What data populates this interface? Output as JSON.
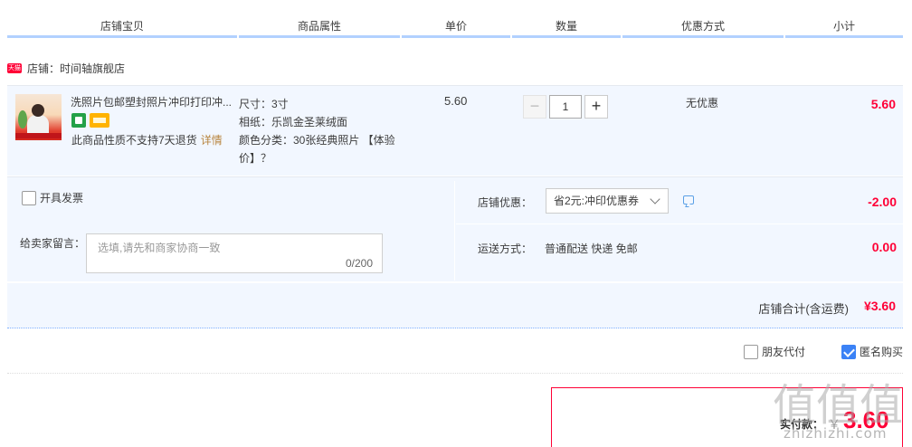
{
  "header": {
    "columns": [
      "店铺宝贝",
      "商品属性",
      "单价",
      "数量",
      "优惠方式",
      "小计"
    ]
  },
  "shop": {
    "badge": "天猫",
    "label": "店铺：时间轴旗舰店"
  },
  "item": {
    "title": "洗照片包邮塑封照片冲印打印冲...",
    "return_note": "此商品性质不支持7天退货",
    "detail_link": "详情",
    "attrs": [
      "尺寸：3寸",
      "相纸：乐凯金圣莱绒面",
      "颜色分类：30张经典照片 【体验价】？"
    ],
    "price": "5.60",
    "quantity": "1",
    "promo": "无优惠",
    "subtotal": "5.60"
  },
  "options": {
    "invoice_label": "开具发票",
    "message_label": "给卖家留言：",
    "message_placeholder": "选填,请先和商家协商一致",
    "message_count": "0/200",
    "coupon_label": "店铺优惠：",
    "coupon_value": "省2元:冲印优惠券",
    "coupon_amount": "-2.00",
    "shipping_label": "运送方式：",
    "shipping_value": "普通配送 快递 免邮",
    "shipping_amount": "0.00"
  },
  "total": {
    "label": "店铺合计(含运费)",
    "amount": "¥3.60"
  },
  "flags": {
    "friend_pay": "朋友代付",
    "anonymous": "匿名购买"
  },
  "pay": {
    "label": "实付款：",
    "currency": "￥",
    "amount": "3.60"
  },
  "watermark": {
    "glyphs": "值值值",
    "domain": "zhizhizhi.com"
  },
  "colors": {
    "accent_red": "#ff0036",
    "row_bg": "#f2f7ff",
    "header_line": "#b2d1ff",
    "checkbox_on": "#3b82f6"
  }
}
